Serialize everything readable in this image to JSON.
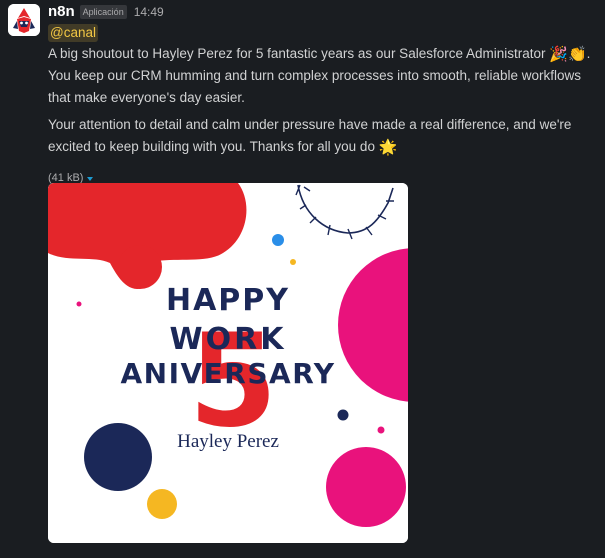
{
  "message": {
    "sender": "n8n",
    "app_badge": "Aplicación",
    "timestamp": "14:49",
    "mention": "@canal",
    "paragraph1": "A big shoutout to Hayley Perez for 5 fantastic years as our Salesforce Administrator",
    "paragraph1_emojis": "🎉👏",
    "paragraph1_end": ".",
    "paragraph1_rest": "You keep our CRM humming and turn complex processes into smooth, reliable workflows that make everyone's day easier.",
    "paragraph2": "Your attention to detail and calm under pressure have made a real difference, and we're excited to keep building with you. Thanks for all you do",
    "paragraph2_emoji": "🌟"
  },
  "attachment": {
    "size": "(41 kB)",
    "image": {
      "title_line1": "HAPPY",
      "title_line2": "WORK",
      "title_line3": "ANIVERSARY",
      "big_number": "5",
      "name": "Hayley Perez"
    }
  },
  "colors": {
    "background": "#1a1d21",
    "mention": "#f2c744",
    "accent_link": "#1d9bd1",
    "card_red": "#e4262b",
    "card_pink": "#e9127c",
    "card_navy": "#1b2858",
    "card_yellow": "#f5b722",
    "card_blue": "#2a8ee8"
  },
  "icons": {
    "avatar": "n8n-logo-icon",
    "dropdown": "caret-down-icon"
  }
}
